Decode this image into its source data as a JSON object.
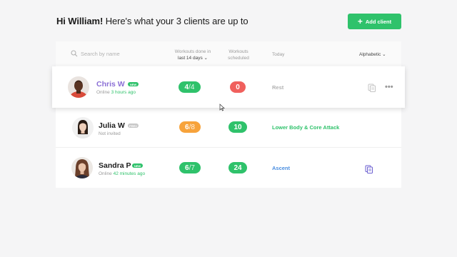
{
  "header": {
    "greeting_name": "Hi William!",
    "greeting_rest": " Here's what your 3 clients are up to",
    "add_client_label": "Add client",
    "add_icon": "+"
  },
  "table": {
    "search_placeholder": "Search by name",
    "col_workouts_line1": "Workouts done in",
    "col_workouts_line2": "last 14 days",
    "col_workouts_caret": "⌄",
    "col_scheduled_line1": "Workouts",
    "col_scheduled_line2": "scheduled",
    "col_today": "Today",
    "sort_label": "Alphabetic",
    "sort_caret": "⌄"
  },
  "clients": [
    {
      "name": "Chris W",
      "badge": "NEW",
      "status_prefix": "Online ",
      "status_highlight": "3 hours ago",
      "workouts_done": "4",
      "workouts_total": "/4",
      "scheduled": "0",
      "today": "Rest",
      "more": "•••"
    },
    {
      "name": "Julia W",
      "badge": "PREV",
      "status_prefix": "Not invited",
      "status_highlight": "",
      "workouts_done": "6",
      "workouts_total": "/8",
      "scheduled": "10",
      "today": "Lower Body & Core Attack"
    },
    {
      "name": "Sandra P",
      "badge": "NEW",
      "status_prefix": "Online ",
      "status_highlight": "42 minutes ago",
      "workouts_done": "6",
      "workouts_total": "/7",
      "scheduled": "24",
      "today": "Ascent"
    }
  ],
  "colors": {
    "green": "#2fc26b",
    "red": "#f0605d",
    "orange": "#f7a33b",
    "purple": "#8b6fd6",
    "blue": "#4a8ee0"
  },
  "icons": [
    "search-icon",
    "plus-icon",
    "note-icon",
    "more-icon",
    "cursor-icon",
    "avatar"
  ]
}
